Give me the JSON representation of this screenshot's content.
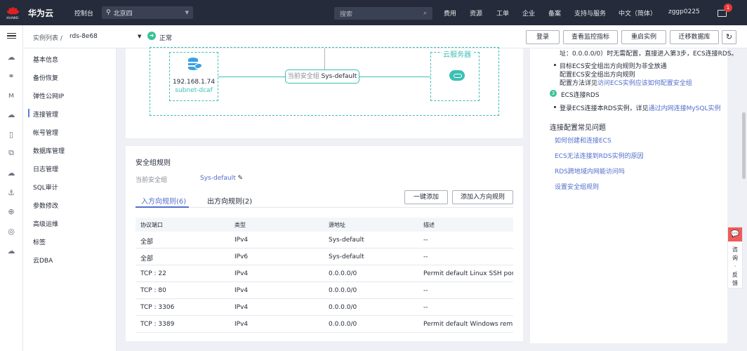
{
  "topbar": {
    "logo_text": "HUAWEI",
    "brand": "华为云",
    "console": "控制台",
    "region": "北京四",
    "search_placeholder": "搜索",
    "nav": [
      "费用",
      "资源",
      "工单",
      "企业",
      "备案",
      "支持与服务",
      "中文（简体）",
      "zggp0225"
    ],
    "mail_badge": "1"
  },
  "header": {
    "breadcrumb": "实例列表",
    "breadcrumb_sep": "/",
    "instance": "rds-8e68",
    "status": "正常",
    "buttons": [
      "登录",
      "查看监控指标",
      "重启实例",
      "迁移数据库"
    ]
  },
  "sidebar": {
    "items": [
      "基本信息",
      "备份恢复",
      "弹性公网IP",
      "连接管理",
      "帐号管理",
      "数据库管理",
      "日志管理",
      "SQL审计",
      "参数修改",
      "高级运维",
      "标签",
      "云DBA"
    ],
    "active_index": 3
  },
  "diagram": {
    "db_ip": "192.168.1.74",
    "subnet": "subnet-dcaf",
    "sg_label": "当前安全组",
    "sg_name": "Sys-default",
    "ecs_label": "云服务器"
  },
  "security": {
    "title": "安全组规则",
    "current_label": "当前安全组",
    "current_value": "Sys-default",
    "tabs": [
      "入方向规则(6)",
      "出方向规则(2)"
    ],
    "buttons": [
      "一键添加",
      "添加入方向规则"
    ],
    "columns": [
      "协议端口",
      "类型",
      "源地址",
      "描述"
    ],
    "rows": [
      [
        "全部",
        "IPv4",
        "Sys-default",
        "--"
      ],
      [
        "全部",
        "IPv6",
        "Sys-default",
        "--"
      ],
      [
        "TCP : 22",
        "IPv4",
        "0.0.0.0/0",
        "Permit default Linux SSH port."
      ],
      [
        "TCP : 80",
        "IPv4",
        "0.0.0.0/0",
        "--"
      ],
      [
        "TCP : 3306",
        "IPv4",
        "0.0.0.0/0",
        "--"
      ],
      [
        "TCP : 3389",
        "IPv4",
        "0.0.0.0/0",
        "Permit default Windows rem..."
      ]
    ]
  },
  "help": {
    "line0": "址：0.0.0.0/0）时无需配置，直接进入第3步，ECS连接RDS。",
    "b1_l1": "目标ECS安全组出方向规则为非全放通",
    "b1_l2": "配置ECS安全组出方向规则",
    "b1_l3_prefix": "配置方法详见",
    "b1_l3_link": "访问ECS实例应该如何配置安全组",
    "step3_num": "3",
    "step3_title": "ECS连接RDS",
    "b2_prefix": "登录ECS连接本RDS实例，详见",
    "b2_link": "通过内网连接MySQL实例",
    "faq_title": "连接配置常见问题",
    "faq_links": [
      "如何创建和连接ECS",
      "ECS无法连接到RDS实例的原因",
      "RDS跨地域内网能访问吗",
      "设置安全组规则"
    ]
  },
  "float": {
    "icon": "💬",
    "text": [
      "咨",
      "询",
      "·",
      "反",
      "馈"
    ]
  }
}
